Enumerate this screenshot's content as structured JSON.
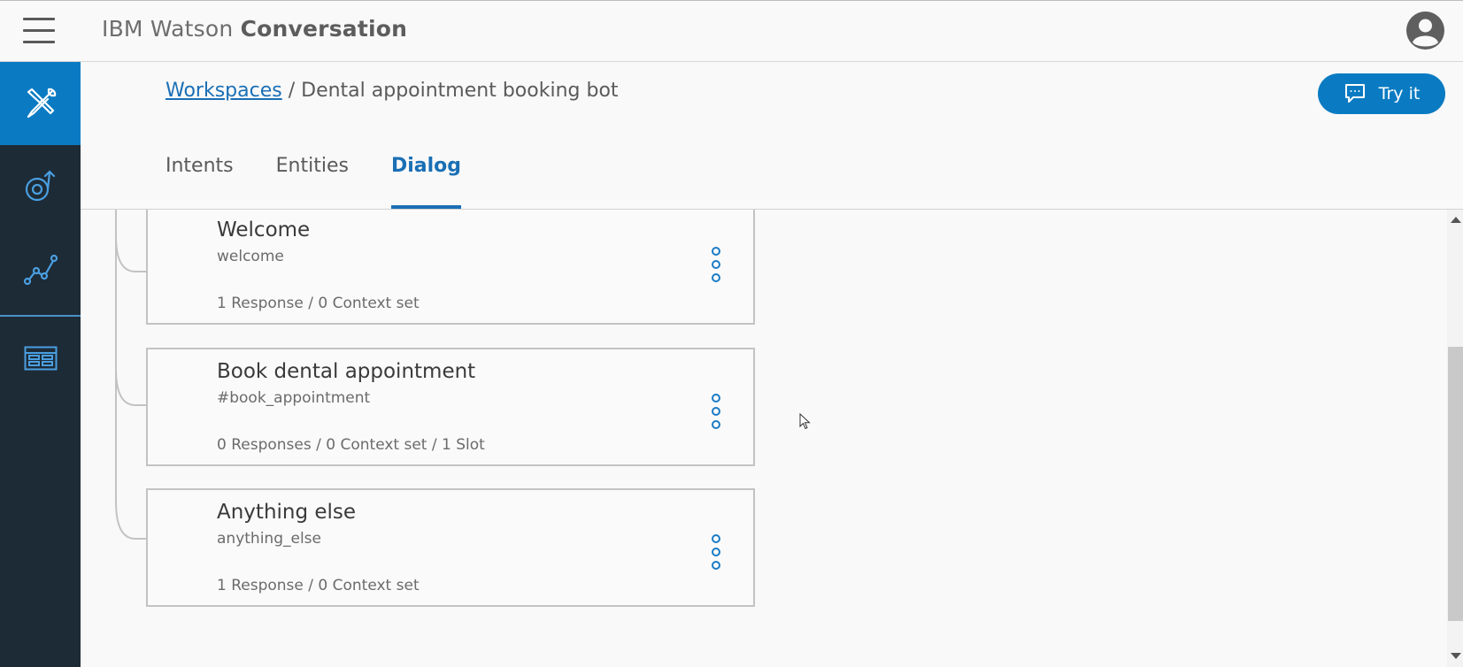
{
  "app": {
    "title_prefix": "IBM Watson",
    "title_bold": "Conversation"
  },
  "icons": {
    "menu": "hamburger-menu-icon",
    "account": "user-avatar-icon",
    "nav_build": "tools-icon",
    "nav_improve": "improve-icon",
    "nav_analytics": "analytics-icon",
    "nav_deploy": "deploy-icon",
    "try_it": "chat-bubble-icon",
    "node_menu": "more-vertical-icon"
  },
  "colors": {
    "accent": "#0a7bc2",
    "nav_bg": "#1d2b37",
    "link": "#1a6fb5"
  },
  "breadcrumb": {
    "link": "Workspaces",
    "separator": " / ",
    "current": "Dental appointment booking bot"
  },
  "try_it": {
    "label": "Try it"
  },
  "tabs": [
    {
      "label": "Intents",
      "active": false
    },
    {
      "label": "Entities",
      "active": false
    },
    {
      "label": "Dialog",
      "active": true
    }
  ],
  "nodes": [
    {
      "title": "Welcome",
      "condition": "welcome",
      "meta": "1 Response / 0 Context set"
    },
    {
      "title": "Book dental appointment",
      "condition": "#book_appointment",
      "meta": "0 Responses / 0 Context set / 1 Slot"
    },
    {
      "title": "Anything else",
      "condition": "anything_else",
      "meta": "1 Response / 0 Context set"
    }
  ]
}
